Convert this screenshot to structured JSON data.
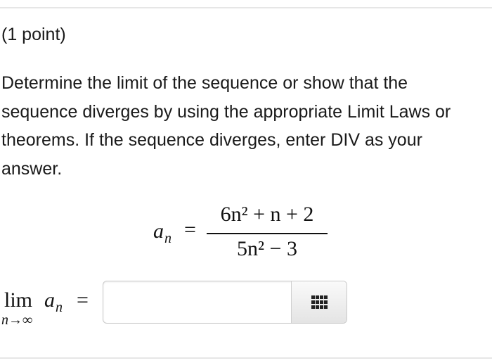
{
  "problem": {
    "points_label": "(1 point)",
    "instructions": "Determine the limit of the sequence or show that the sequence diverges by using the appropriate Limit Laws or theorems. If the sequence diverges, enter DIV as your answer."
  },
  "sequence": {
    "name": "a",
    "subscript": "n",
    "equals": "=",
    "numerator": "6n² + n + 2",
    "denominator": "5n² − 3"
  },
  "answer_row": {
    "limit_word": "lim",
    "limit_under": "n→∞",
    "variable": "a",
    "variable_subscript": "n",
    "equals": "=",
    "input_value": "",
    "input_placeholder": "",
    "palette_icon": "grid-keypad-icon"
  }
}
